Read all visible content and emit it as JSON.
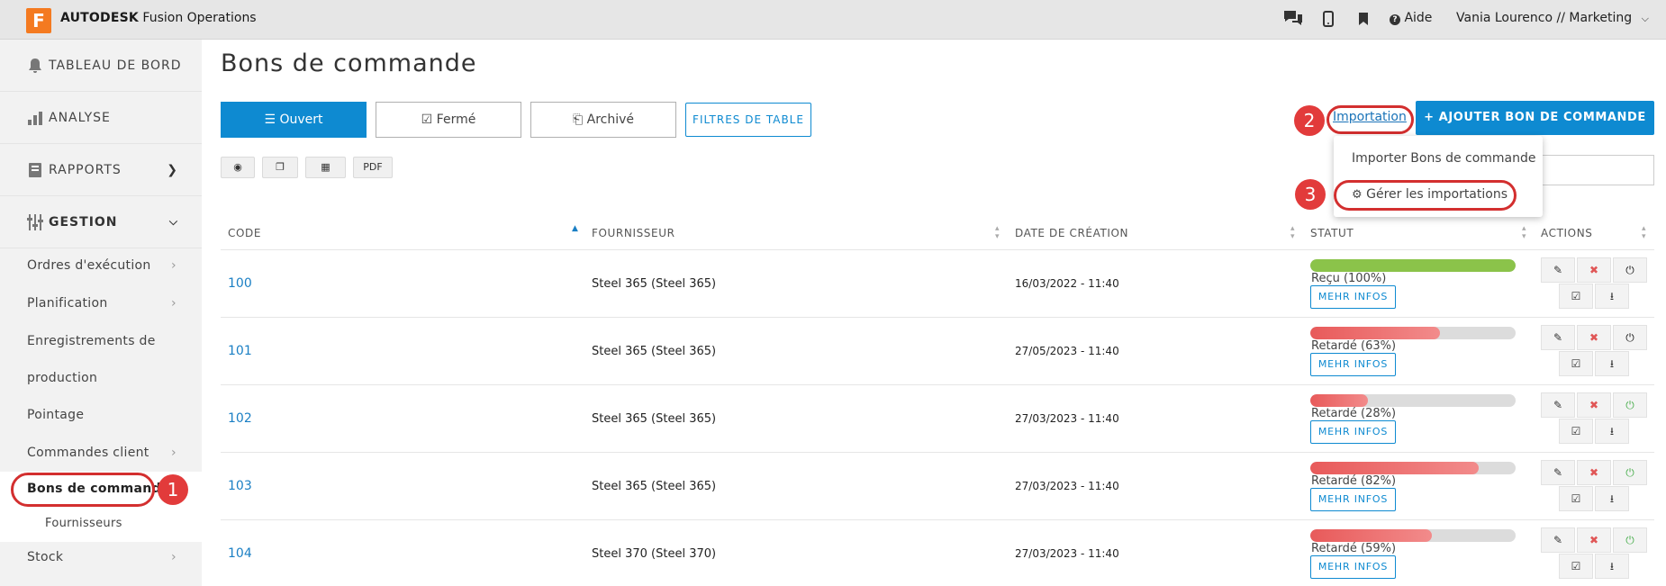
{
  "topbar": {
    "logo_letter": "F",
    "brand": "AUTODESK",
    "product": "Fusion Operations",
    "help": "Aide",
    "user": "Vania Lourenco // Marketing"
  },
  "sidebar": {
    "main": [
      {
        "label": "TABLEAU DE BORD",
        "icon": "bell-icon"
      },
      {
        "label": "ANALYSE",
        "icon": "bar-chart-icon"
      },
      {
        "label": "RAPPORTS",
        "icon": "book-icon"
      },
      {
        "label": "GESTION",
        "icon": "sliders-icon"
      }
    ],
    "sub": [
      {
        "label": "Ordres d'exécution"
      },
      {
        "label": "Planification"
      },
      {
        "label": "Enregistrements de"
      },
      {
        "label": "production"
      },
      {
        "label": "Pointage"
      },
      {
        "label": "Commandes client"
      },
      {
        "label": "Bons de commande"
      },
      {
        "label": "Fournisseurs"
      },
      {
        "label": "Stock"
      }
    ]
  },
  "callouts": [
    "1",
    "2",
    "3"
  ],
  "page": {
    "title": "Bons de commande",
    "tabs": [
      "Ouvert",
      "Fermé",
      "Archivé"
    ],
    "filters": "FILTRES DE TABLE",
    "import": "Importation",
    "add": "+ AJOUTER BON DE COMMANDE",
    "tools": [
      "PDF"
    ],
    "dropdown": [
      "Importer Bons de commande",
      "Gérer les importations"
    ]
  },
  "table": {
    "headers": [
      "CODE",
      "FOURNISSEUR",
      "DATE DE CRÉATION",
      "STATUT",
      "ACTIONS"
    ],
    "info_label": "MEHR INFOS",
    "rows": [
      {
        "code": "100",
        "supplier": "Steel 365 (Steel 365)",
        "date": "16/03/2022 - 11:40",
        "status": "Reçu (100%)",
        "pct": 100,
        "color": "#8bc34a",
        "power_color": "#222"
      },
      {
        "code": "101",
        "supplier": "Steel 365 (Steel 365)",
        "date": "27/05/2023 - 11:40",
        "status": "Retardé (63%)",
        "pct": 63,
        "color": "#e85a5a",
        "power_color": "#222"
      },
      {
        "code": "102",
        "supplier": "Steel 365 (Steel 365)",
        "date": "27/03/2023 - 11:40",
        "status": "Retardé (28%)",
        "pct": 28,
        "color": "#e85a5a",
        "power_color": "#4caf50"
      },
      {
        "code": "103",
        "supplier": "Steel 365 (Steel 365)",
        "date": "27/03/2023 - 11:40",
        "status": "Retardé (82%)",
        "pct": 82,
        "color": "#e85a5a",
        "power_color": "#4caf50"
      },
      {
        "code": "104",
        "supplier": "Steel 370 (Steel 370)",
        "date": "27/03/2023 - 11:40",
        "status": "Retardé (59%)",
        "pct": 59,
        "color": "#e85a5a",
        "power_color": "#4caf50"
      }
    ]
  }
}
